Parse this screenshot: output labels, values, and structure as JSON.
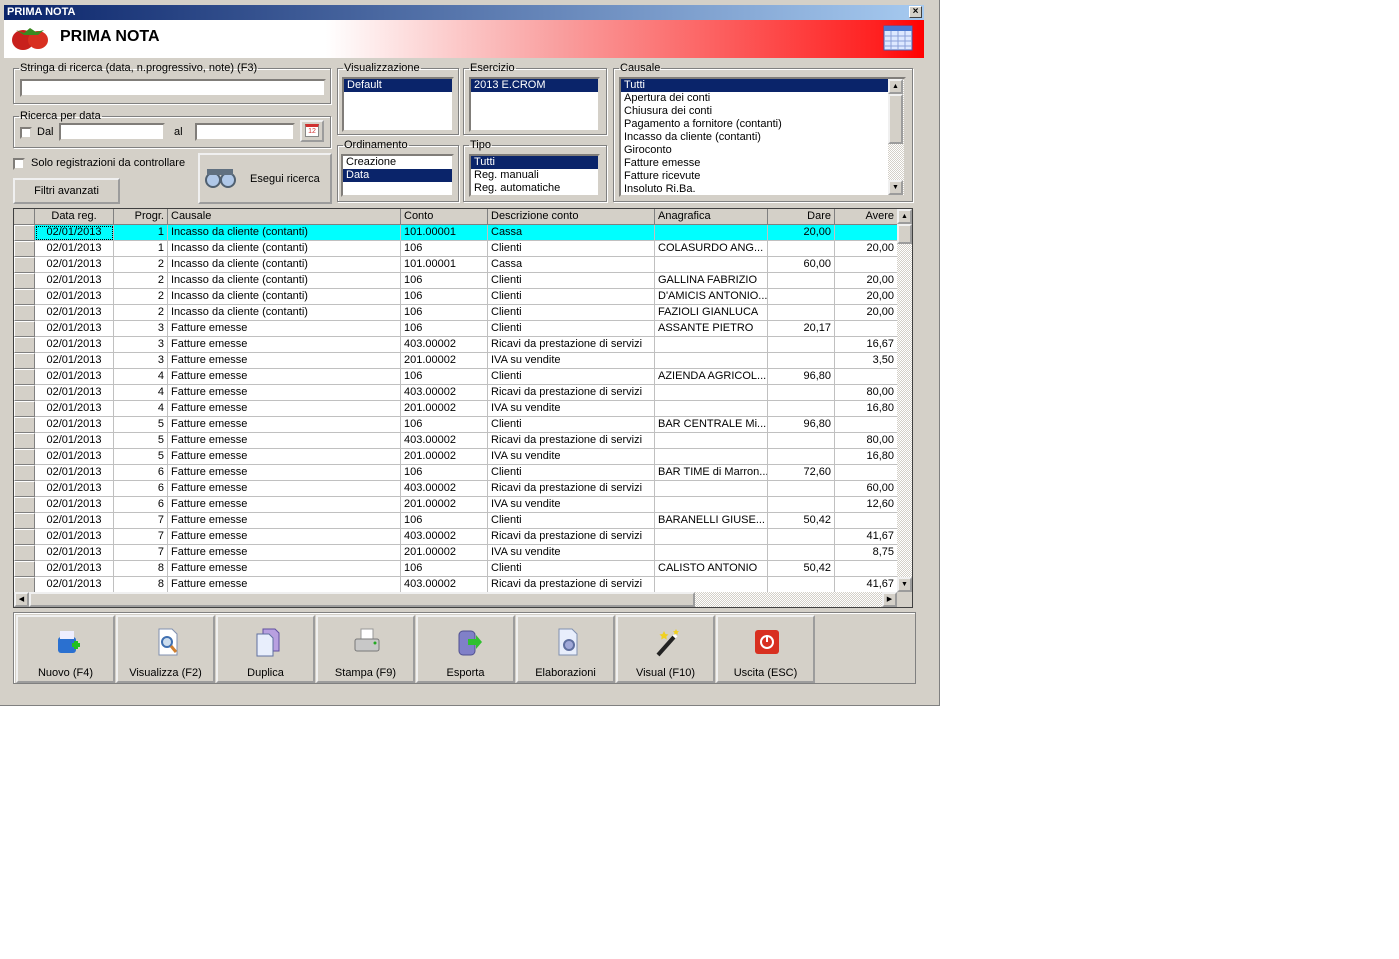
{
  "window": {
    "title": "PRIMA NOTA",
    "close": "×"
  },
  "banner": {
    "title": "PRIMA NOTA"
  },
  "search": {
    "legend": "Stringa di ricerca (data, n.progressivo, note) (F3)",
    "value": ""
  },
  "date_search": {
    "legend": "Ricerca per data",
    "from_label": "Dal",
    "to_label": "al",
    "from": "",
    "to": "",
    "calendar_day": "12"
  },
  "only_check_label": "Solo registrazioni da controllare",
  "filters_button": "Filtri avanzati",
  "run_search_button": "Esegui ricerca",
  "visualizzazione": {
    "legend": "Visualizzazione",
    "items": [
      {
        "label": "Default",
        "selected": true
      }
    ]
  },
  "ordinamento": {
    "legend": "Ordinamento",
    "items": [
      {
        "label": "Creazione",
        "selected": false
      },
      {
        "label": "Data",
        "selected": true
      }
    ]
  },
  "esercizio": {
    "legend": "Esercizio",
    "items": [
      {
        "label": "2013 E.CROM",
        "selected": true
      }
    ]
  },
  "tipo": {
    "legend": "Tipo",
    "items": [
      {
        "label": "Tutti",
        "selected": true
      },
      {
        "label": "Reg. manuali",
        "selected": false
      },
      {
        "label": "Reg. automatiche",
        "selected": false
      }
    ]
  },
  "causale": {
    "legend": "Causale",
    "items": [
      {
        "label": "Tutti",
        "selected": true
      },
      {
        "label": "Apertura dei conti"
      },
      {
        "label": "Chiusura dei conti"
      },
      {
        "label": "Pagamento a fornitore (contanti)"
      },
      {
        "label": "Incasso da cliente (contanti)"
      },
      {
        "label": "Giroconto"
      },
      {
        "label": "Fatture emesse"
      },
      {
        "label": "Fatture ricevute"
      },
      {
        "label": "Insoluto Ri.Ba."
      }
    ]
  },
  "table": {
    "columns": [
      "Data reg.",
      "Progr.",
      "Causale",
      "Conto",
      "Descrizione conto",
      "Anagrafica",
      "Dare",
      "Avere"
    ],
    "rows": [
      [
        "02/01/2013",
        "1",
        "Incasso da cliente (contanti)",
        "101.00001",
        "Cassa",
        "",
        "20,00",
        ""
      ],
      [
        "02/01/2013",
        "1",
        "Incasso da cliente (contanti)",
        "106",
        "Clienti",
        "COLASURDO ANG...",
        "",
        "20,00"
      ],
      [
        "02/01/2013",
        "2",
        "Incasso da cliente (contanti)",
        "101.00001",
        "Cassa",
        "",
        "60,00",
        ""
      ],
      [
        "02/01/2013",
        "2",
        "Incasso da cliente (contanti)",
        "106",
        "Clienti",
        "GALLINA FABRIZIO",
        "",
        "20,00"
      ],
      [
        "02/01/2013",
        "2",
        "Incasso da cliente (contanti)",
        "106",
        "Clienti",
        "D'AMICIS ANTONIO...",
        "",
        "20,00"
      ],
      [
        "02/01/2013",
        "2",
        "Incasso da cliente (contanti)",
        "106",
        "Clienti",
        "FAZIOLI GIANLUCA",
        "",
        "20,00"
      ],
      [
        "02/01/2013",
        "3",
        "Fatture emesse",
        "106",
        "Clienti",
        "ASSANTE PIETRO",
        "20,17",
        ""
      ],
      [
        "02/01/2013",
        "3",
        "Fatture emesse",
        "403.00002",
        "Ricavi da prestazione di servizi",
        "",
        "",
        "16,67"
      ],
      [
        "02/01/2013",
        "3",
        "Fatture emesse",
        "201.00002",
        "IVA su vendite",
        "",
        "",
        "3,50"
      ],
      [
        "02/01/2013",
        "4",
        "Fatture emesse",
        "106",
        "Clienti",
        "AZIENDA AGRICOL...",
        "96,80",
        ""
      ],
      [
        "02/01/2013",
        "4",
        "Fatture emesse",
        "403.00002",
        "Ricavi da prestazione di servizi",
        "",
        "",
        "80,00"
      ],
      [
        "02/01/2013",
        "4",
        "Fatture emesse",
        "201.00002",
        "IVA su vendite",
        "",
        "",
        "16,80"
      ],
      [
        "02/01/2013",
        "5",
        "Fatture emesse",
        "106",
        "Clienti",
        "BAR CENTRALE Mi...",
        "96,80",
        ""
      ],
      [
        "02/01/2013",
        "5",
        "Fatture emesse",
        "403.00002",
        "Ricavi da prestazione di servizi",
        "",
        "",
        "80,00"
      ],
      [
        "02/01/2013",
        "5",
        "Fatture emesse",
        "201.00002",
        "IVA su vendite",
        "",
        "",
        "16,80"
      ],
      [
        "02/01/2013",
        "6",
        "Fatture emesse",
        "106",
        "Clienti",
        "BAR TIME di Marron...",
        "72,60",
        ""
      ],
      [
        "02/01/2013",
        "6",
        "Fatture emesse",
        "403.00002",
        "Ricavi da prestazione di servizi",
        "",
        "",
        "60,00"
      ],
      [
        "02/01/2013",
        "6",
        "Fatture emesse",
        "201.00002",
        "IVA su vendite",
        "",
        "",
        "12,60"
      ],
      [
        "02/01/2013",
        "7",
        "Fatture emesse",
        "106",
        "Clienti",
        "BARANELLI GIUSE...",
        "50,42",
        ""
      ],
      [
        "02/01/2013",
        "7",
        "Fatture emesse",
        "403.00002",
        "Ricavi da prestazione di servizi",
        "",
        "",
        "41,67"
      ],
      [
        "02/01/2013",
        "7",
        "Fatture emesse",
        "201.00002",
        "IVA su vendite",
        "",
        "",
        "8,75"
      ],
      [
        "02/01/2013",
        "8",
        "Fatture emesse",
        "106",
        "Clienti",
        "CALISTO ANTONIO",
        "50,42",
        ""
      ],
      [
        "02/01/2013",
        "8",
        "Fatture emesse",
        "403.00002",
        "Ricavi da prestazione di servizi",
        "",
        "",
        "41,67"
      ]
    ],
    "selected_row": 0,
    "highlight_color": "#00ffff"
  },
  "toolbar": [
    {
      "label": "Nuovo (F4)",
      "icon": "new-icon"
    },
    {
      "label": "Visualizza (F2)",
      "icon": "view-icon"
    },
    {
      "label": "Duplica",
      "icon": "duplicate-icon"
    },
    {
      "label": "Stampa (F9)",
      "icon": "print-icon"
    },
    {
      "label": "Esporta",
      "icon": "export-icon"
    },
    {
      "label": "Elaborazioni",
      "icon": "process-icon"
    },
    {
      "label": "Visual (F10)",
      "icon": "magic-wand-icon"
    },
    {
      "label": "Uscita (ESC)",
      "icon": "exit-icon"
    }
  ]
}
